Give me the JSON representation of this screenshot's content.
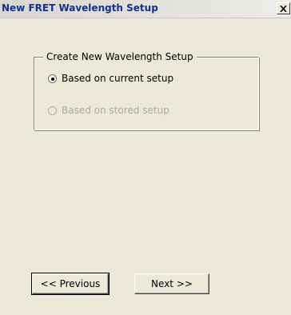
{
  "window": {
    "title": "New FRET Wavelength Setup",
    "close_glyph": "✕"
  },
  "group": {
    "legend": "Create New Wavelength Setup",
    "options": [
      {
        "label": "Based on current setup",
        "selected": true,
        "enabled": true
      },
      {
        "label": "Based on stored setup",
        "selected": false,
        "enabled": false
      }
    ]
  },
  "buttons": {
    "previous": "<< Previous",
    "next": "Next >>"
  }
}
